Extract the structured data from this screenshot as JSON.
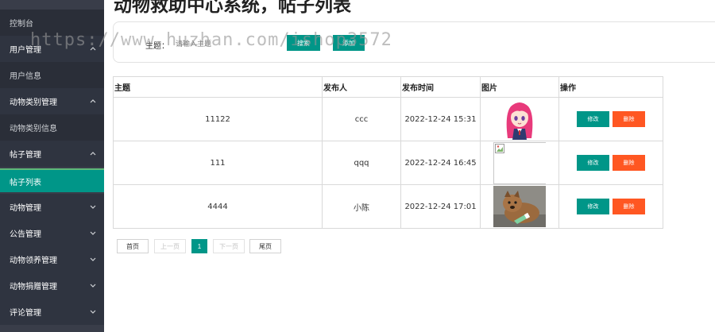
{
  "sidebar": {
    "items": [
      {
        "label": "控制台",
        "kind": "sub"
      },
      {
        "label": "用户管理",
        "kind": "group",
        "chevron": "chevron-up-icon"
      },
      {
        "label": "用户信息",
        "kind": "sub"
      },
      {
        "label": "动物类别管理",
        "kind": "group",
        "chevron": "chevron-up-icon"
      },
      {
        "label": "动物类别信息",
        "kind": "sub"
      },
      {
        "label": "帖子管理",
        "kind": "group",
        "chevron": "chevron-up-icon"
      },
      {
        "label": "帖子列表",
        "kind": "active"
      },
      {
        "label": "动物管理",
        "kind": "group",
        "chevron": "chevron-down-icon"
      },
      {
        "label": "公告管理",
        "kind": "group",
        "chevron": "chevron-down-icon"
      },
      {
        "label": "动物领养管理",
        "kind": "group",
        "chevron": "chevron-down-icon"
      },
      {
        "label": "动物捐赠管理",
        "kind": "group",
        "chevron": "chevron-down-icon"
      },
      {
        "label": "评论管理",
        "kind": "group",
        "chevron": "chevron-down-icon"
      }
    ]
  },
  "main": {
    "title": "动物救助中心系统，帖子列表",
    "search": {
      "label": "主题：",
      "placeholder": "请输入主题",
      "value": "",
      "search_label": "搜索",
      "add_label": "添加"
    },
    "table": {
      "headers": [
        "主题",
        "发布人",
        "发布时间",
        "图片",
        "操作"
      ],
      "rows": [
        {
          "subject": "11122",
          "author": "ccc",
          "time": "2022-12-24 15:31",
          "image": "anime-girl-thumbnail"
        },
        {
          "subject": "111",
          "author": "qqq",
          "time": "2022-12-24 16:45",
          "image": "broken-image-icon"
        },
        {
          "subject": "4444",
          "author": "小陈",
          "time": "2022-12-24 17:01",
          "image": "puppy-photo-thumbnail"
        }
      ],
      "edit_label": "修改",
      "delete_label": "删除"
    },
    "pagination": {
      "first": "首页",
      "prev": "上一页",
      "current": "1",
      "next": "下一页",
      "last": "尾页"
    }
  },
  "watermark": "https://www.huzhan.com/ishop3572",
  "colors": {
    "accent": "#009688",
    "danger": "#FF5722",
    "sidebar": "#393D49"
  }
}
